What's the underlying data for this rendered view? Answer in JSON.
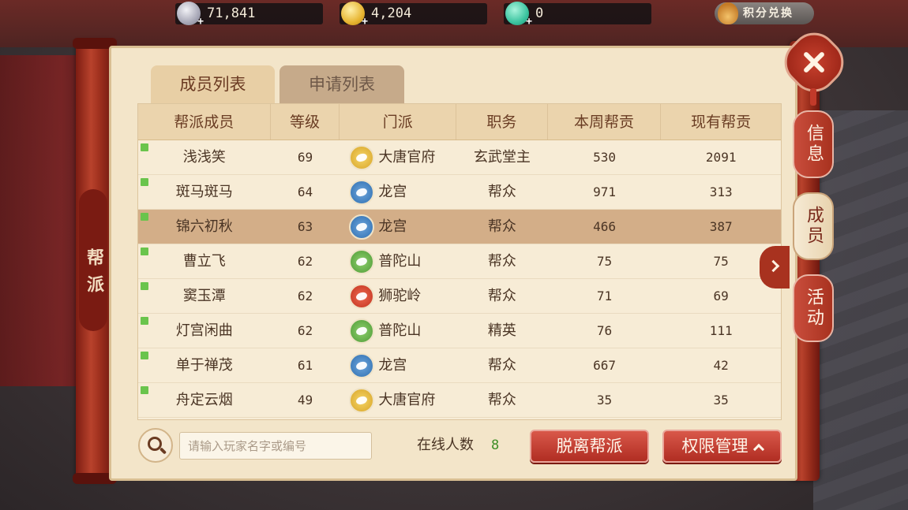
{
  "currency": {
    "silver": "71,841",
    "gold": "4,204",
    "jade": "0",
    "points_exchange": "积分兑换"
  },
  "side_label": "帮派",
  "tabs": [
    {
      "label": "成员列表",
      "active": true
    },
    {
      "label": "申请列表",
      "active": false
    }
  ],
  "table": {
    "headers": [
      "帮派成员",
      "等级",
      "门派",
      "职务",
      "本周帮贡",
      "现有帮贡"
    ],
    "rows": [
      {
        "name": "浅浅笑",
        "level": "69",
        "sect": "大唐官府",
        "sect_icon": "tang-icon",
        "role": "玄武堂主",
        "weekly": "530",
        "total": "2091",
        "online": true,
        "selected": false
      },
      {
        "name": "斑马斑马",
        "level": "64",
        "sect": "龙宫",
        "sect_icon": "dragon-icon",
        "role": "帮众",
        "weekly": "971",
        "total": "313",
        "online": true,
        "selected": false
      },
      {
        "name": "锦六初秋",
        "level": "63",
        "sect": "龙宫",
        "sect_icon": "dragon-icon",
        "role": "帮众",
        "weekly": "466",
        "total": "387",
        "online": true,
        "selected": true
      },
      {
        "name": "曹立飞",
        "level": "62",
        "sect": "普陀山",
        "sect_icon": "lotus-icon",
        "role": "帮众",
        "weekly": "75",
        "total": "75",
        "online": true,
        "selected": false
      },
      {
        "name": "窦玉潭",
        "level": "62",
        "sect": "狮驼岭",
        "sect_icon": "lion-icon",
        "role": "帮众",
        "weekly": "71",
        "total": "69",
        "online": true,
        "selected": false
      },
      {
        "name": "灯宫闲曲",
        "level": "62",
        "sect": "普陀山",
        "sect_icon": "lotus-icon",
        "role": "精英",
        "weekly": "76",
        "total": "111",
        "online": true,
        "selected": false
      },
      {
        "name": "单于禅茂",
        "level": "61",
        "sect": "龙宫",
        "sect_icon": "dragon-icon",
        "role": "帮众",
        "weekly": "667",
        "total": "42",
        "online": true,
        "selected": false
      },
      {
        "name": "舟定云烟",
        "level": "49",
        "sect": "大唐官府",
        "sect_icon": "tang-icon",
        "role": "帮众",
        "weekly": "35",
        "total": "35",
        "online": true,
        "selected": false
      }
    ]
  },
  "search": {
    "placeholder": "请输入玩家名字或编号"
  },
  "online": {
    "label": "在线人数",
    "count": "8"
  },
  "buttons": {
    "leave": "脱离帮派",
    "permissions": "权限管理"
  },
  "side_tabs": [
    {
      "label": "信息",
      "active": false
    },
    {
      "label": "成员",
      "active": true
    },
    {
      "label": "活动",
      "active": false
    }
  ],
  "colors": {
    "accent_red": "#b02d22",
    "online_green": "#6ac44c",
    "selected_row": "#d3ae88"
  }
}
